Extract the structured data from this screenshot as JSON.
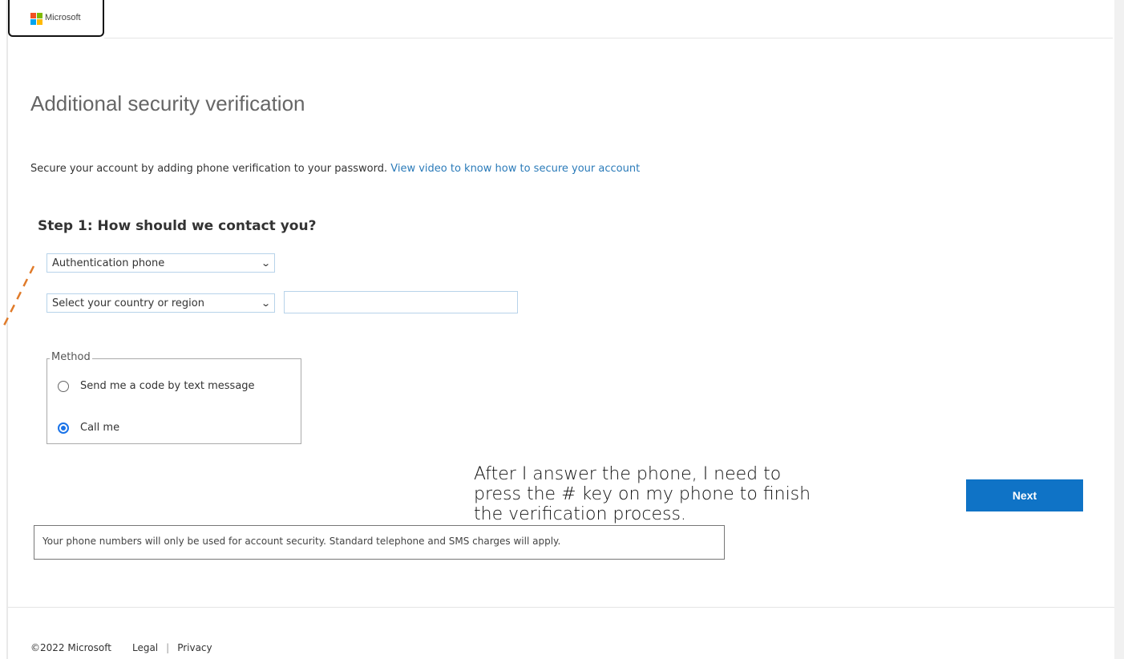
{
  "brand": {
    "name": "Microsoft",
    "logo_colors": [
      "#f25022",
      "#7fba00",
      "#00a4ef",
      "#ffb900"
    ]
  },
  "page": {
    "title": "Additional security verification",
    "intro_text": "Secure your account by adding phone verification to your password.",
    "intro_link": "View video to know how to secure your account"
  },
  "step1": {
    "heading": "Step 1: How should we contact you?",
    "contact_select_value": "Authentication phone",
    "country_select_value": "Select your country or region",
    "phone_value": ""
  },
  "method": {
    "legend": "Method",
    "options": [
      {
        "label": "Send me a code by text message",
        "selected": false
      },
      {
        "label": "Call me",
        "selected": true
      }
    ]
  },
  "actions": {
    "next_label": "Next"
  },
  "note": "Your phone numbers will only be used for account security. Standard telephone and SMS charges will apply.",
  "annotation": "After I answer the phone, I need to press the # key on my phone to finish the verification process.",
  "footer": {
    "copyright": "©2022 Microsoft",
    "legal": "Legal",
    "separator": "|",
    "privacy": "Privacy"
  },
  "colors": {
    "accent": "#0f73c6",
    "link": "#2b7bb9",
    "annotation_dash": "#e07b2a"
  }
}
